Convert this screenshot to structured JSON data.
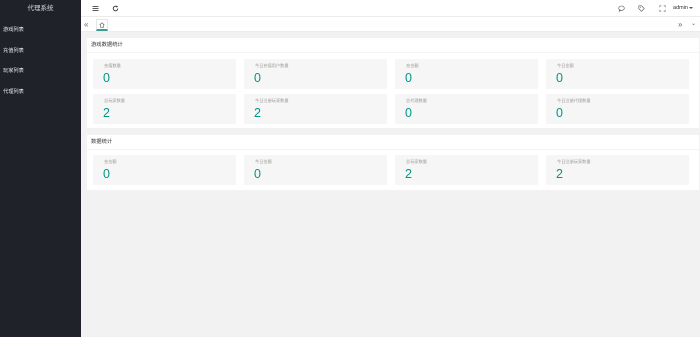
{
  "sidebar": {
    "logo": "代理系统",
    "items": [
      {
        "label": "游戏列表"
      },
      {
        "label": "充值列表"
      },
      {
        "label": "玩家列表"
      },
      {
        "label": "代理列表"
      }
    ]
  },
  "header": {
    "user": "admin"
  },
  "game_stats": {
    "title": "游戏数据统计",
    "cards": [
      {
        "label": "充值数量",
        "value": "0"
      },
      {
        "label": "今日充值用户数量",
        "value": "0"
      },
      {
        "label": "充金额",
        "value": "0"
      },
      {
        "label": "今日金额",
        "value": "0"
      },
      {
        "label": "总玩家数量",
        "value": "2"
      },
      {
        "label": "今日注册玩家数量",
        "value": "2"
      },
      {
        "label": "总代理数量",
        "value": "0"
      },
      {
        "label": "今日注册代理数量",
        "value": "0"
      }
    ]
  },
  "data_stats": {
    "title": "数据统计",
    "cards": [
      {
        "label": "充金额",
        "value": "0"
      },
      {
        "label": "今日金额",
        "value": "0"
      },
      {
        "label": "总玩家数量",
        "value": "2"
      },
      {
        "label": "今日注册玩家数量",
        "value": "2"
      }
    ]
  },
  "colors": {
    "sidebar_bg": "#20222a",
    "accent": "#009688",
    "page_bg": "#f2f2f2"
  }
}
